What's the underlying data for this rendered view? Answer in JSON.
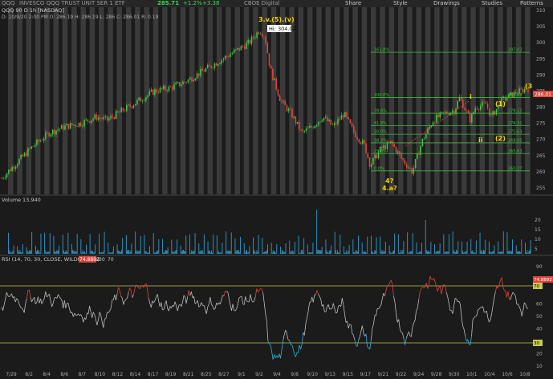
{
  "topbar": {
    "symbol": "QQQ",
    "description": "INVESCO QQQ TRUST UNIT SER 1 ETF",
    "last_price": "285.71",
    "change": "+1.2%",
    "change_abs": "+3.38",
    "exchange_link": "CBOE Digital",
    "buttons": [
      "Share",
      "Style",
      "Drawings",
      "Studies",
      "Patterns"
    ]
  },
  "chart_header": {
    "title": "QQQ 90 D 1h [NASDAQ]",
    "ohlc": "D: 10/9/20 2:00 PM  O: 286.19  H: 286.19  L: 286  C: 286.01  R: 0.19"
  },
  "annotations": {
    "wave_top": "3.v.(5).(v)",
    "hi_label": "Hi: 304.02",
    "wave_i": "i",
    "wave_ii": "ii",
    "wave_1": "(1)",
    "wave_2": "(2)",
    "wave_3": "(3)?",
    "wave_4": "4?",
    "wave_4a": "4.a?"
  },
  "fib_levels": [
    {
      "label": "161.8%",
      "price": "297.02"
    },
    {
      "label": "100.0%",
      "price": "282.98"
    },
    {
      "label": "78.6%",
      "price": "278.12"
    },
    {
      "label": "61.8%",
      "price": "274.31"
    },
    {
      "label": "50.0%",
      "price": "271.63"
    },
    {
      "label": "38.2%",
      "price": "268.95"
    },
    {
      "label": "23.6%",
      "price": "265.63"
    },
    {
      "label": "0.0%",
      "price": "260.27"
    }
  ],
  "price_tag": "286.01",
  "price_axis": [
    "310",
    "305",
    "300",
    "295",
    "290",
    "285",
    "280",
    "275",
    "270",
    "265",
    "260",
    "255"
  ],
  "volume_panel": {
    "label": "Volume",
    "value": "13,940",
    "axis": [
      "20",
      "15",
      "10",
      "5"
    ]
  },
  "rsi_panel": {
    "label": "RSI (14, 70, 30, CLOSE, WILDERS, no)",
    "value": "74.8892",
    "ob": "30",
    "os": "70",
    "axis": [
      "90",
      "80",
      "70",
      "60",
      "50",
      "40",
      "30",
      "20",
      "10"
    ],
    "value_tag": "74.8892",
    "ob_tag": "70",
    "os_tag": "30"
  },
  "date_axis": [
    "7/29",
    "8/2",
    "8/4",
    "8/6",
    "8/7",
    "8/10",
    "8/12",
    "8/14",
    "8/17",
    "8/19",
    "8/21",
    "8/25",
    "8/27",
    "9/1",
    "9/2",
    "9/4",
    "9/8",
    "9/10",
    "9/13",
    "9/15",
    "9/17",
    "9/21",
    "9/22",
    "9/24",
    "9/28",
    "9/30",
    "10/1",
    "10/4",
    "10/6",
    "10/8"
  ],
  "chart_data": {
    "type": "line",
    "x_start": "7/27",
    "x_end": "10/9",
    "ylim": [
      253,
      311
    ],
    "price_points": [
      [
        0,
        258
      ],
      [
        0.03,
        263
      ],
      [
        0.06,
        268
      ],
      [
        0.09,
        272
      ],
      [
        0.12,
        274
      ],
      [
        0.15,
        275
      ],
      [
        0.18,
        277
      ],
      [
        0.2,
        276
      ],
      [
        0.23,
        279
      ],
      [
        0.26,
        282
      ],
      [
        0.29,
        285
      ],
      [
        0.32,
        286
      ],
      [
        0.35,
        288
      ],
      [
        0.38,
        291
      ],
      [
        0.41,
        294
      ],
      [
        0.44,
        297
      ],
      [
        0.47,
        300
      ],
      [
        0.49,
        304
      ],
      [
        0.5,
        302
      ],
      [
        0.51,
        292
      ],
      [
        0.53,
        282
      ],
      [
        0.55,
        278
      ],
      [
        0.57,
        272
      ],
      [
        0.59,
        274
      ],
      [
        0.61,
        277
      ],
      [
        0.63,
        274
      ],
      [
        0.65,
        278
      ],
      [
        0.67,
        272
      ],
      [
        0.69,
        268
      ],
      [
        0.7,
        262
      ],
      [
        0.72,
        267
      ],
      [
        0.74,
        269
      ],
      [
        0.76,
        264
      ],
      [
        0.78,
        260
      ],
      [
        0.8,
        270
      ],
      [
        0.82,
        276
      ],
      [
        0.84,
        278
      ],
      [
        0.86,
        279
      ],
      [
        0.87,
        283
      ],
      [
        0.89,
        276
      ],
      [
        0.9,
        280
      ],
      [
        0.92,
        281
      ],
      [
        0.93,
        277
      ],
      [
        0.95,
        282
      ],
      [
        0.97,
        284
      ],
      [
        1,
        286
      ]
    ]
  },
  "colors": {
    "up": "#3cc43c",
    "down": "#e0443c",
    "fib": "#3dbb3d",
    "label": "#f5d300",
    "volume": "#2f9ccf",
    "rsi_line": "#bdbdbd",
    "rsi_hi": "#e0443c",
    "rsi_lo": "#29b6d6"
  }
}
